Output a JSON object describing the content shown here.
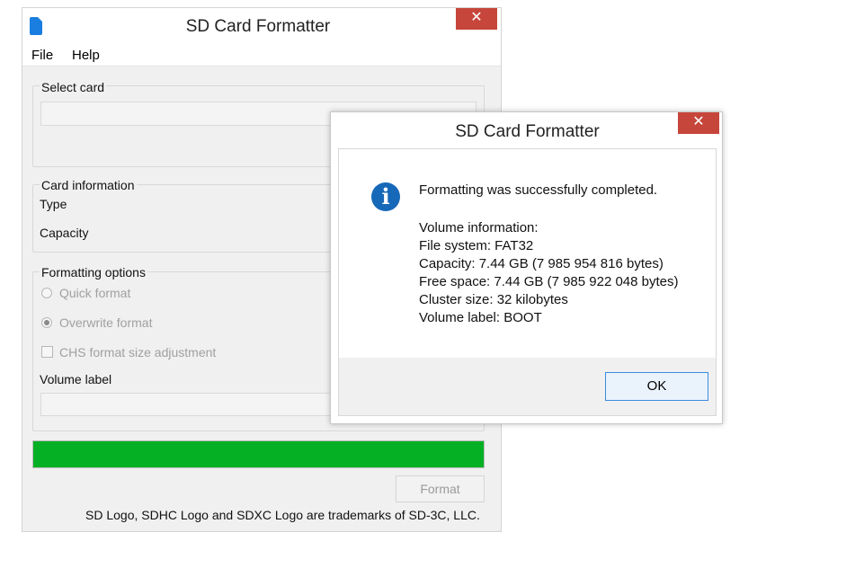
{
  "main_window": {
    "title": "SD Card Formatter",
    "close_glyph": "✕",
    "menu": [
      "File",
      "Help"
    ],
    "select_card": {
      "label": "Select card",
      "value": ""
    },
    "card_information": {
      "label": "Card information",
      "type_label": "Type",
      "capacity_label": "Capacity"
    },
    "formatting_options": {
      "label": "Formatting options",
      "quick_format": "Quick format",
      "overwrite_format": "Overwrite format",
      "chs_adjustment": "CHS format size adjustment",
      "volume_label": "Volume label",
      "volume_label_value": "",
      "selected_option": "Overwrite format"
    },
    "progress": 1.0,
    "progress_color": "#06b025",
    "format_button": "Format",
    "trademark": "SD Logo, SDHC Logo and SDXC Logo are trademarks of SD-3C, LLC."
  },
  "dialog": {
    "title": "SD Card Formatter",
    "close_glyph": "✕",
    "icon": "info-icon",
    "icon_glyph": "i",
    "message": "Formatting was successfully completed.",
    "volume_info": [
      "Volume information:",
      "File system: FAT32",
      "Capacity: 7.44 GB (7 985 954 816 bytes)",
      "Free space: 7.44 GB (7 985 922 048 bytes)",
      "Cluster size: 32 kilobytes",
      "Volume label: BOOT"
    ],
    "ok_button": "OK"
  },
  "colors": {
    "close_button": "#c7463b",
    "accent": "#1668b8"
  }
}
